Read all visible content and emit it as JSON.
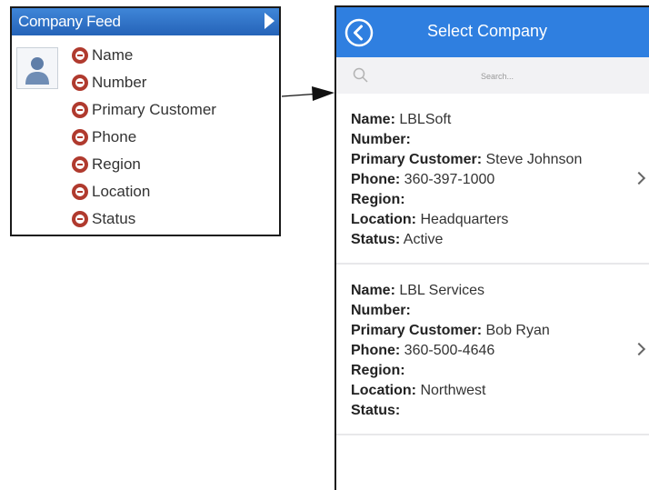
{
  "feed_panel": {
    "title": "Company Feed",
    "fields": [
      "Name",
      "Number",
      "Primary Customer",
      "Phone",
      "Region",
      "Location",
      "Status"
    ]
  },
  "phone": {
    "title": "Select Company",
    "search": {
      "placeholder": "Search..."
    },
    "companies": [
      {
        "rows": [
          {
            "label": "Name:",
            "value": "LBLSoft"
          },
          {
            "label": "Number:",
            "value": ""
          },
          {
            "label": "Primary Customer:",
            "value": "Steve Johnson"
          },
          {
            "label": "Phone:",
            "value": "360-397-1000"
          },
          {
            "label": "Region:",
            "value": ""
          },
          {
            "label": "Location:",
            "value": "Headquarters"
          },
          {
            "label": "Status:",
            "value": "Active"
          }
        ]
      },
      {
        "rows": [
          {
            "label": "Name:",
            "value": "LBL Services"
          },
          {
            "label": "Number:",
            "value": ""
          },
          {
            "label": "Primary Customer:",
            "value": "Bob Ryan"
          },
          {
            "label": "Phone:",
            "value": "360-500-4646"
          },
          {
            "label": "Region:",
            "value": ""
          },
          {
            "label": "Location:",
            "value": "Northwest"
          },
          {
            "label": "Status:",
            "value": ""
          }
        ]
      }
    ]
  },
  "colors": {
    "feed_header": "#2f6fc8",
    "phone_header": "#2f7fe0",
    "remove_icon": "#b03a2e",
    "search_bar": "#f2f2f4"
  },
  "icons": {
    "feed_arrow": "play-arrow-icon",
    "avatar": "user-avatar-icon",
    "field_remove": "remove-circle-icon",
    "back": "back-arrow-icon",
    "search": "search-icon",
    "row_chevron": "chevron-right-icon"
  }
}
